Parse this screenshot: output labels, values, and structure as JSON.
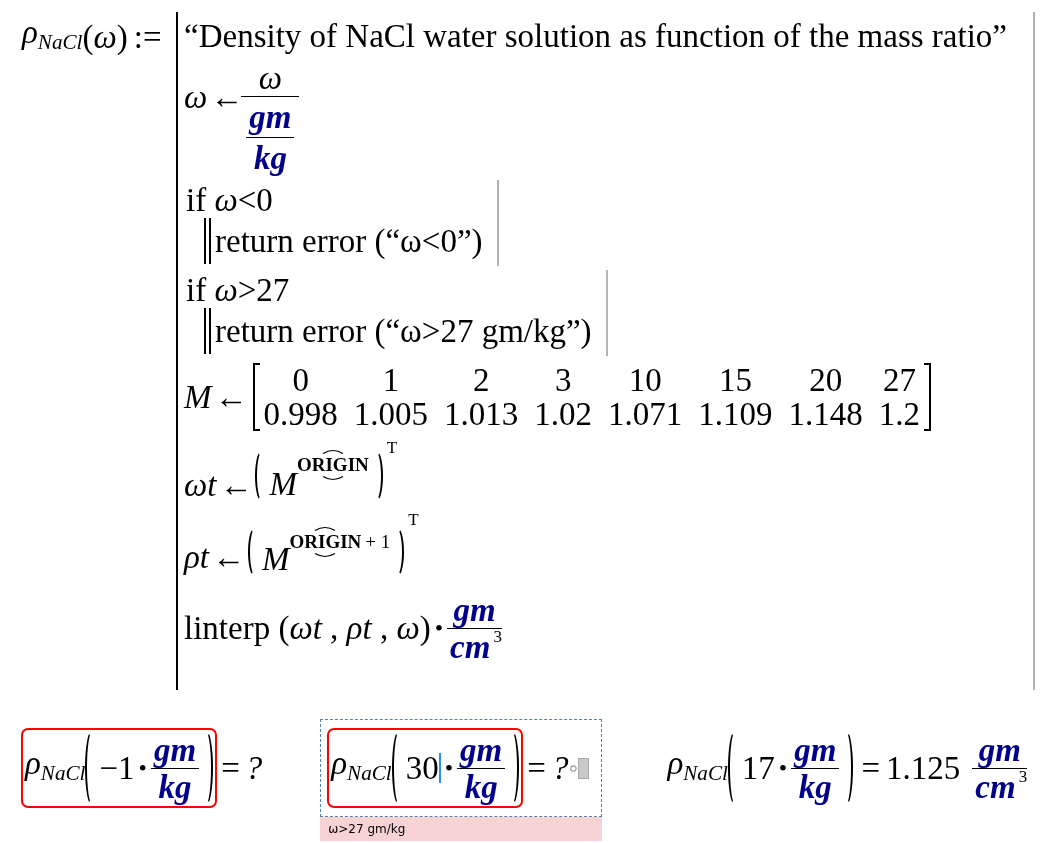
{
  "definition": {
    "name": "ρ$_{NaCl}$",
    "argument": "(*ω*)",
    "operator": ":=",
    "statements": [
      {
        "kind": "comment",
        "text": "“Density of NaCl water solution as function of the mass ratio”"
      },
      {
        "kind": "unit_division",
        "target": "ω",
        "arrow": "←",
        "numerator": "ω",
        "unit_numerator": "gm",
        "unit_denominator": "kg"
      },
      {
        "kind": "guard",
        "condition": "if *ω*<0",
        "action": "return error (“ω<0”)"
      },
      {
        "kind": "guard",
        "condition": "if *ω*>27",
        "action": "return error (“ω>27 gm/kg”)"
      },
      {
        "kind": "matrix",
        "target": "M",
        "arrow": "←",
        "rows": [
          [
            "0",
            "1",
            "2",
            "3",
            "10",
            "15",
            "20",
            "27"
          ],
          [
            "0.998",
            "1.005",
            "1.013",
            "1.02",
            "1.071",
            "1.109",
            "1.148",
            "1.2"
          ]
        ]
      },
      {
        "kind": "column",
        "target": "ωt",
        "arrow": "←",
        "matrix": "M",
        "column": "ORIGIN",
        "transpose": "T"
      },
      {
        "kind": "column",
        "target": "ρt",
        "arrow": "←",
        "matrix": "M",
        "column": "ORIGIN",
        "offset": "+ 1",
        "transpose": "T"
      },
      {
        "kind": "result",
        "call": "linterp (*ωt* , *ρt* , *ω*)",
        "operator": "•",
        "unit_numerator": "gm",
        "unit_denominator": "cm",
        "unit_exponent": "3"
      }
    ]
  },
  "evaluations": [
    {
      "name": "ρ$_{NaCl}$",
      "value": "−1",
      "operator": "•",
      "unit_numerator": "gm",
      "unit_denominator": "kg",
      "equals": "=",
      "result": "?",
      "error": true,
      "selected": false
    },
    {
      "name": "ρ$_{NaCl}$",
      "value": "30",
      "operator": "•",
      "unit_numerator": "gm",
      "unit_denominator": "kg",
      "equals": "=",
      "result": "?",
      "error": true,
      "selected": true,
      "error_message": "ω>27 gm/kg"
    },
    {
      "name": "ρ$_{NaCl}$",
      "value": "17",
      "operator": "•",
      "unit_numerator": "gm",
      "unit_denominator": "kg",
      "equals": "=",
      "result": "1.125",
      "result_unit": {
        "numerator": "gm",
        "denominator": "cm",
        "exponent": "3"
      },
      "error": false,
      "selected": false
    }
  ]
}
